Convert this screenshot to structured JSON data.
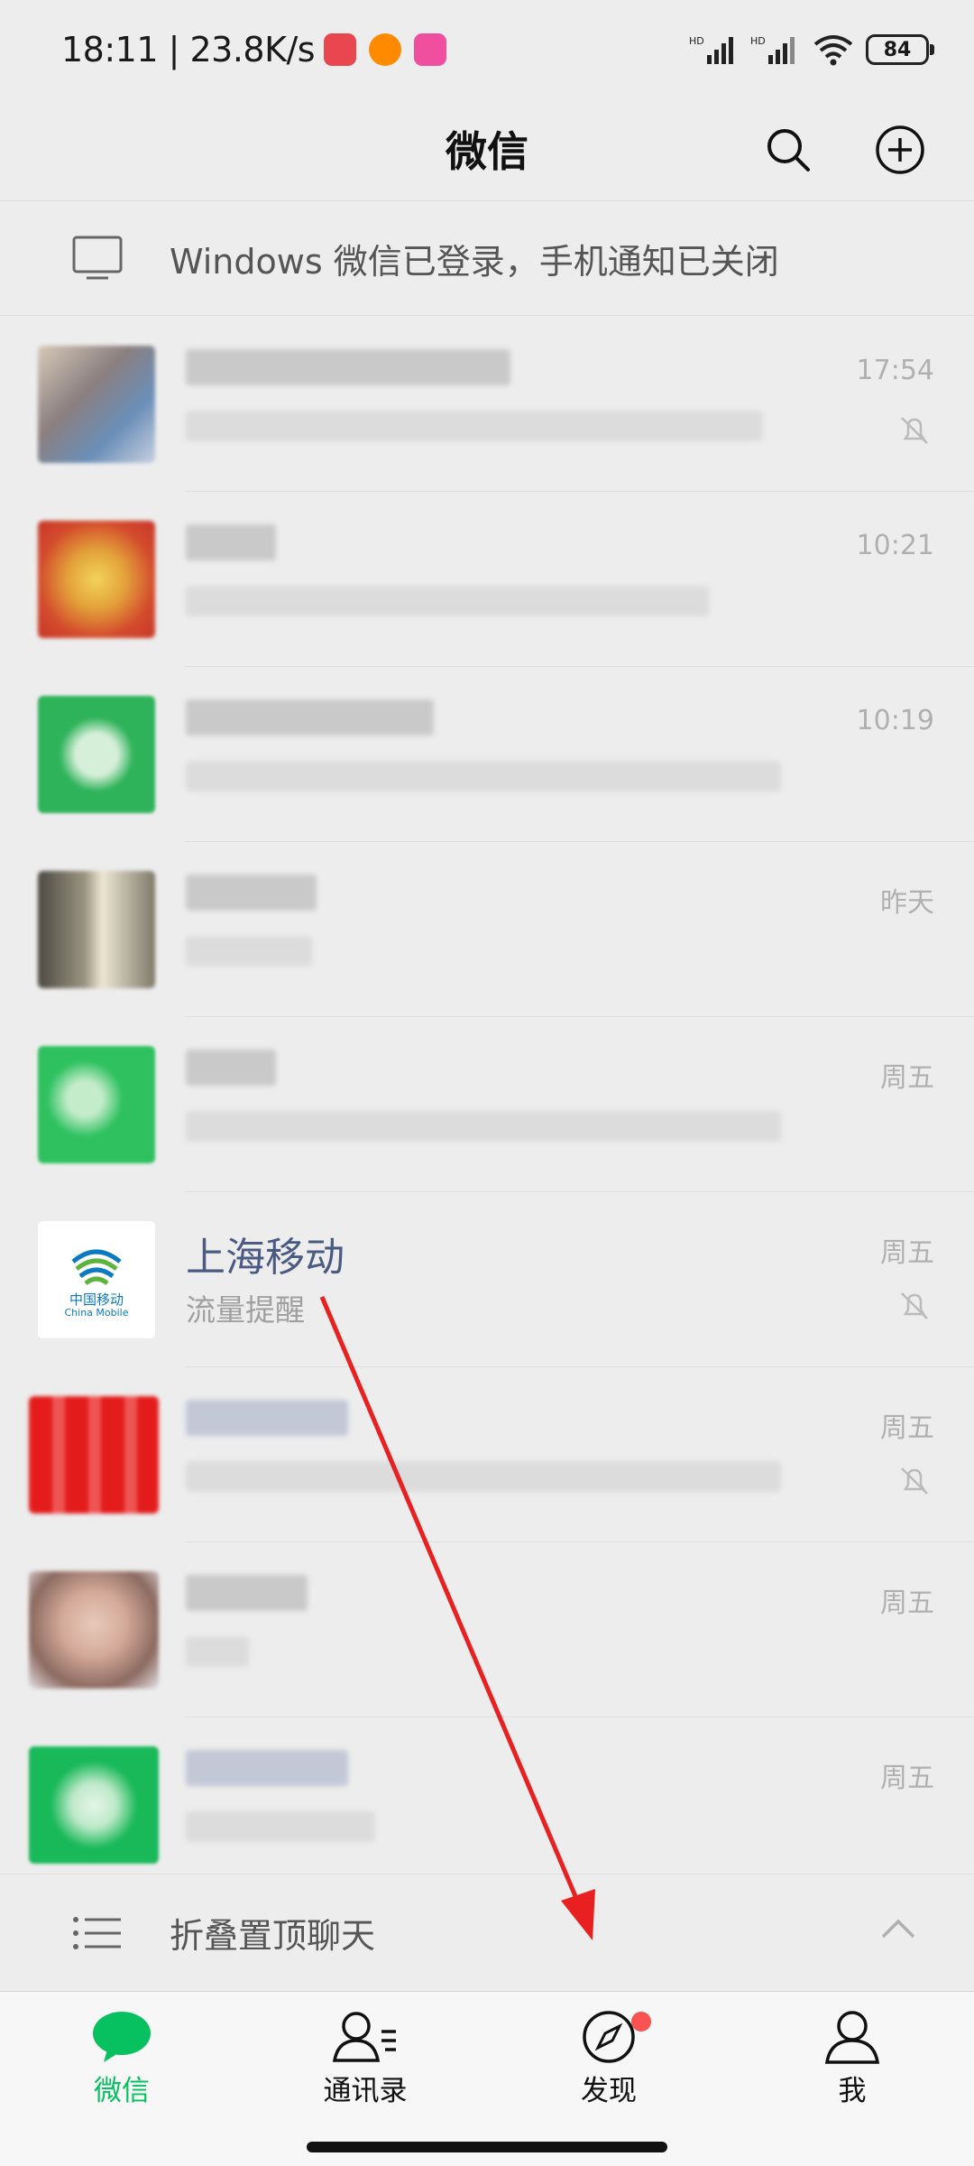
{
  "status_bar": {
    "time": "18:11 | 23.8K/s",
    "battery": "84",
    "app_badges": [
      "#e8474f",
      "#ff8a00",
      "#f04fa0"
    ]
  },
  "header": {
    "title": "微信"
  },
  "banner": {
    "text": "Windows 微信已登录，手机通知已关闭"
  },
  "chats": [
    {
      "name": "",
      "snippet": "",
      "time": "17:54",
      "muted": true,
      "avatar_color": "#9a8d88"
    },
    {
      "name": "",
      "snippet": "",
      "time": "10:21",
      "muted": false,
      "avatar_color": "#d94a2a"
    },
    {
      "name": "",
      "snippet": "",
      "time": "10:19",
      "muted": false,
      "avatar_color": "#2fb35a"
    },
    {
      "name": "",
      "snippet": "",
      "time": "昨天",
      "muted": false,
      "avatar_color": "#6e6658"
    },
    {
      "name": "",
      "snippet": "",
      "time": "周五",
      "muted": false,
      "avatar_color": "#2fb35a"
    },
    {
      "name": "上海移动",
      "snippet": "流量提醒",
      "time": "周五",
      "muted": true,
      "avatar_color": "#ffffff",
      "avatar_text": "中国移动",
      "avatar_subtext": "China Mobile"
    },
    {
      "name": "",
      "snippet": "",
      "time": "周五",
      "muted": true,
      "avatar_color": "#e31b1b"
    },
    {
      "name": "",
      "snippet": "",
      "time": "周五",
      "muted": false,
      "avatar_color": "#c8a89a"
    },
    {
      "name": "",
      "snippet": "",
      "time": "周五",
      "muted": false,
      "avatar_color": "#19b95a"
    }
  ],
  "fold_bar": {
    "text": "折叠置顶聊天"
  },
  "tabs": [
    {
      "label": "微信",
      "active": true
    },
    {
      "label": "通讯录",
      "active": false
    },
    {
      "label": "发现",
      "active": false,
      "badge_dot": true
    },
    {
      "label": "我",
      "active": false
    }
  ],
  "colors": {
    "accent": "#07c160",
    "badge": "#fa5151",
    "annotation_arrow": "#e82020"
  }
}
